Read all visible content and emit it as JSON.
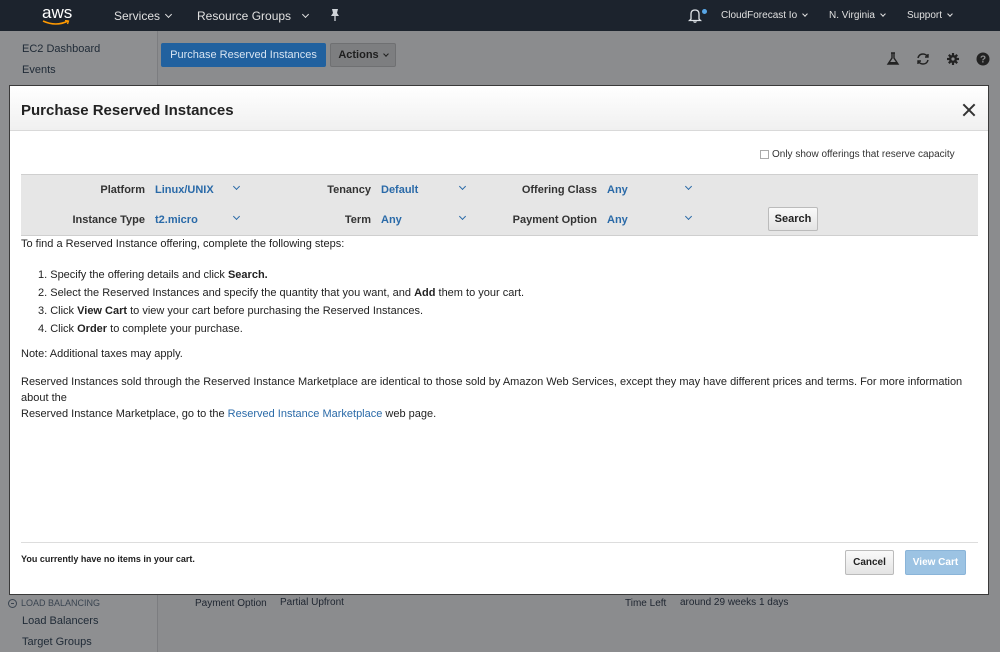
{
  "topnav": {
    "logo_text": "aws",
    "services": "Services",
    "resource_groups": "Resource Groups",
    "account": "CloudForecast Io",
    "region": "N. Virginia",
    "support": "Support"
  },
  "sidebar": {
    "items": [
      "EC2 Dashboard",
      "Events"
    ],
    "section": "LOAD BALANCING",
    "bottom_items": [
      "Load Balancers",
      "Target Groups"
    ]
  },
  "background": {
    "purchase_button": "Purchase Reserved Instances",
    "actions_button": "Actions",
    "payment_option_label": "Payment Option",
    "payment_option_value": "Partial Upfront",
    "time_left_label": "Time Left",
    "time_left_value": "around 29 weeks 1 days"
  },
  "modal": {
    "title": "Purchase Reserved Instances",
    "reserve_capacity_label": "Only show offerings that reserve capacity",
    "filters": {
      "platform_label": "Platform",
      "platform_value": "Linux/UNIX",
      "tenancy_label": "Tenancy",
      "tenancy_value": "Default",
      "offering_class_label": "Offering Class",
      "offering_class_value": "Any",
      "instance_type_label": "Instance Type",
      "instance_type_value": "t2.micro",
      "term_label": "Term",
      "term_value": "Any",
      "payment_option_label": "Payment Option",
      "payment_option_value": "Any",
      "search_button": "Search"
    },
    "intro": "To find a Reserved Instance offering, complete the following steps:",
    "steps": {
      "s1_pre": "1. Specify the offering details and click ",
      "s1_bold": "Search.",
      "s2_pre": "2. Select the Reserved Instances and specify the quantity that you want, and ",
      "s2_bold": "Add",
      "s2_post": " them to your cart.",
      "s3_pre": "3. Click ",
      "s3_bold": "View Cart",
      "s3_post": " to view your cart before purchasing the Reserved Instances.",
      "s4_pre": "4. Click ",
      "s4_bold": "Order",
      "s4_post": " to complete your purchase."
    },
    "note": "Note: Additional taxes may apply.",
    "marketplace_text_1": "Reserved Instances sold through the Reserved Instance Marketplace are identical to those sold by Amazon Web Services, except they may have different prices and terms. For more information about the",
    "marketplace_text_2": "Reserved Instance Marketplace, go to the ",
    "marketplace_link": "Reserved Instance Marketplace",
    "marketplace_text_3": " web page.",
    "cart_message": "You currently have no items in your cart.",
    "cancel_button": "Cancel",
    "view_cart_button": "View Cart"
  },
  "icons": [
    "bell-icon",
    "pin-icon",
    "flask-icon",
    "refresh-icon",
    "gear-icon",
    "help-icon",
    "close-icon",
    "chevron-down-icon"
  ],
  "colors": {
    "nav_bg": "#1c232d",
    "link": "#2a6aa8",
    "primary_button": "#21619f",
    "view_cart_disabled": "#9cc3e3"
  }
}
